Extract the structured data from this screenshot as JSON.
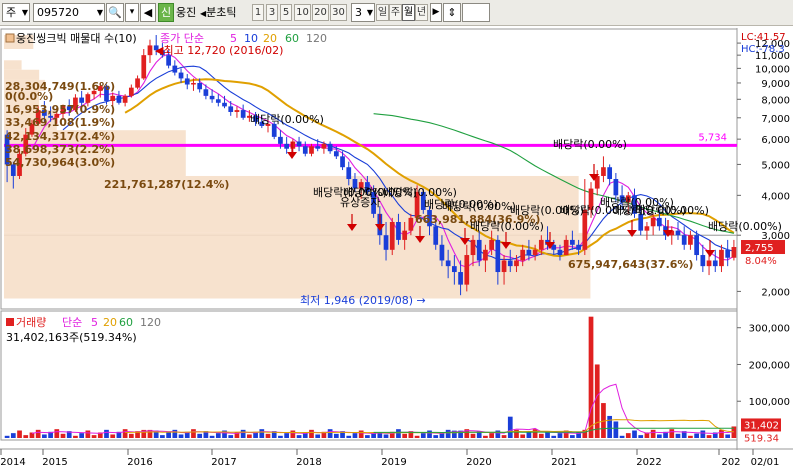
{
  "toolbar": {
    "market_select": "주",
    "stock_code": "095720",
    "credit_badge": "신",
    "stock_name_short": "웅진",
    "split_tick_label": "분초틱",
    "periods": [
      "1",
      "3",
      "5",
      "10",
      "20",
      "30"
    ],
    "period_count": "3",
    "period_units": [
      "일",
      "주",
      "월",
      "년"
    ],
    "selected_unit": "월"
  },
  "price_panel": {
    "legend_name": "웅진씽크빅 매물대 수(10)",
    "legend_ma": [
      "종가 단순",
      "5",
      "10",
      "20",
      "60",
      "120"
    ],
    "lc_label": "LC:41.57",
    "hc_label": "HC:-78.3",
    "high_label": "최고 12,720 (2016/02)",
    "low_label": "최저 1,946 (2019/08)",
    "ref_line_label": "5,734",
    "current_price": "2,755",
    "current_pct": "8.04%",
    "y_ticks": [
      "12,000",
      "11,000",
      "10,000",
      "9,000",
      "8,000",
      "7,000",
      "6,000",
      "5,000",
      "4,000",
      "3,000",
      "2,000"
    ],
    "volume_profile_labels": [
      "28,304,749(1.6%)",
      "0(0.0%)",
      "16,953,957(0.9%)",
      "33,469,108(1.9%)",
      "42,134,317(2.4%)",
      "38,698,373(2.2%)",
      "54,730,964(3.0%)",
      "221,761,287(12.4%)",
      "663,981,884(36.9%)",
      "675,947,643(37.6%)"
    ],
    "dividend_labels": [
      "배당락(0.00%)",
      "배당락(0.00%)",
      "배당락(0.00%)",
      "배당락(0.00%)",
      "배당락(0.00%)",
      "배당락(0.00%)",
      "배당락(0.00%)",
      "배당락(0.00%)",
      "배당락(0.00%)",
      "배당락(0.00%)",
      "배당락(0.00%)",
      "배당락(0.00%)",
      "배당락(0.00%)",
      "배당락(0.00%)"
    ],
    "rights_label": "유상증자"
  },
  "volume_panel": {
    "legend": [
      "거래량",
      "단순",
      "5",
      "20",
      "60",
      "120"
    ],
    "value_label": "31,402,163주(519.34%)",
    "y_ticks": [
      "300,000",
      "200,000",
      "100,000"
    ],
    "current_volume": "31,402",
    "current_pct": "519.34"
  },
  "x_axis": [
    "2014",
    "2015",
    "2016",
    "2017",
    "2018",
    "2019",
    "2020",
    "2021",
    "2022",
    "202",
    "02/01"
  ],
  "colors": {
    "up": "#e02020",
    "down": "#1a3ed8",
    "ma5": "#e020e0",
    "ma10": "#1a3ed8",
    "ma20": "#e0a000",
    "ma60": "#20a040",
    "ref_line": "#ff00ff",
    "profile": "#f6dfc9"
  },
  "chart_data": {
    "type": "candlestick",
    "start": "2014-02",
    "interval": "month",
    "ohlc": [
      [
        6200,
        6400,
        4400,
        5000
      ],
      [
        5000,
        5100,
        4200,
        4600
      ],
      [
        4600,
        5600,
        4500,
        5400
      ],
      [
        5400,
        6500,
        5300,
        6200
      ],
      [
        6200,
        6900,
        6100,
        6700
      ],
      [
        6700,
        7600,
        6600,
        7400
      ],
      [
        7400,
        7900,
        6800,
        7100
      ],
      [
        7100,
        7600,
        6800,
        7000
      ],
      [
        7000,
        7500,
        6700,
        7200
      ],
      [
        7200,
        7700,
        6900,
        7600
      ],
      [
        7600,
        8000,
        7100,
        7400
      ],
      [
        7400,
        8300,
        7300,
        8100
      ],
      [
        8100,
        8500,
        7600,
        7800
      ],
      [
        7800,
        8400,
        7600,
        8300
      ],
      [
        8300,
        8800,
        8000,
        8500
      ],
      [
        8500,
        9000,
        8100,
        8800
      ],
      [
        8800,
        8900,
        7700,
        7900
      ],
      [
        7900,
        8400,
        7500,
        8200
      ],
      [
        8200,
        8500,
        7700,
        7800
      ],
      [
        7800,
        8300,
        7600,
        8200
      ],
      [
        8200,
        8900,
        8100,
        8700
      ],
      [
        8700,
        9500,
        8600,
        9300
      ],
      [
        9300,
        11500,
        9200,
        11000
      ],
      [
        11000,
        12300,
        10400,
        11800
      ],
      [
        11800,
        12720,
        11000,
        11400
      ],
      [
        11400,
        12000,
        10800,
        11000
      ],
      [
        11000,
        11400,
        10000,
        10200
      ],
      [
        10200,
        10600,
        9500,
        9700
      ],
      [
        9700,
        10000,
        9000,
        9300
      ],
      [
        9300,
        9600,
        8600,
        8900
      ],
      [
        8900,
        9300,
        8500,
        9000
      ],
      [
        9000,
        9300,
        8400,
        8600
      ],
      [
        8600,
        8900,
        8000,
        8200
      ],
      [
        8200,
        8600,
        7800,
        8000
      ],
      [
        8000,
        8300,
        7600,
        7800
      ],
      [
        7800,
        8200,
        7500,
        7600
      ],
      [
        7600,
        7900,
        7100,
        7300
      ],
      [
        7300,
        7600,
        7000,
        7400
      ],
      [
        7400,
        7700,
        6900,
        7000
      ],
      [
        7000,
        7400,
        6800,
        7100
      ],
      [
        7100,
        7300,
        6600,
        6800
      ],
      [
        6800,
        7100,
        6500,
        6600
      ],
      [
        6600,
        6900,
        6300,
        6700
      ],
      [
        6700,
        6800,
        6000,
        6100
      ],
      [
        6100,
        6400,
        5600,
        5800
      ],
      [
        5800,
        6100,
        5400,
        5600
      ],
      [
        5600,
        6000,
        5400,
        5900
      ],
      [
        5900,
        6100,
        5500,
        5700
      ],
      [
        5700,
        5900,
        5300,
        5400
      ],
      [
        5400,
        5800,
        5300,
        5700
      ],
      [
        5700,
        6000,
        5500,
        5600
      ],
      [
        5600,
        5900,
        5400,
        5800
      ],
      [
        5800,
        5900,
        5400,
        5500
      ],
      [
        5500,
        5700,
        5200,
        5300
      ],
      [
        5300,
        5500,
        4800,
        4900
      ],
      [
        4900,
        5100,
        4300,
        4500
      ],
      [
        4500,
        4700,
        4100,
        4200
      ],
      [
        4200,
        4500,
        3900,
        4400
      ],
      [
        4400,
        4600,
        4000,
        4100
      ],
      [
        4100,
        4300,
        3400,
        3500
      ],
      [
        3500,
        3700,
        2800,
        3000
      ],
      [
        3000,
        3300,
        2500,
        2700
      ],
      [
        2700,
        3400,
        2600,
        3300
      ],
      [
        3300,
        3500,
        2800,
        2900
      ],
      [
        2900,
        3300,
        2700,
        3100
      ],
      [
        3100,
        3500,
        3000,
        3400
      ],
      [
        3400,
        4300,
        3300,
        4100
      ],
      [
        4100,
        4200,
        3500,
        3600
      ],
      [
        3600,
        3700,
        3000,
        3200
      ],
      [
        3200,
        3300,
        2700,
        2800
      ],
      [
        2800,
        3000,
        2400,
        2500
      ],
      [
        2500,
        2700,
        2200,
        2400
      ],
      [
        2400,
        2600,
        2100,
        2300
      ],
      [
        2300,
        2500,
        1946,
        2100
      ],
      [
        2100,
        2800,
        2000,
        2600
      ],
      [
        2600,
        3000,
        2400,
        2900
      ],
      [
        2900,
        3100,
        2400,
        2500
      ],
      [
        2500,
        2800,
        2300,
        2700
      ],
      [
        2700,
        3100,
        2600,
        2900
      ],
      [
        2900,
        3000,
        2100,
        2300
      ],
      [
        2300,
        2600,
        2100,
        2500
      ],
      [
        2500,
        2700,
        2300,
        2400
      ],
      [
        2400,
        2600,
        2300,
        2500
      ],
      [
        2500,
        2800,
        2400,
        2700
      ],
      [
        2700,
        2900,
        2500,
        2600
      ],
      [
        2600,
        2800,
        2500,
        2700
      ],
      [
        2700,
        3000,
        2600,
        2900
      ],
      [
        2900,
        3200,
        2700,
        2800
      ],
      [
        2800,
        2900,
        2600,
        2700
      ],
      [
        2700,
        2800,
        2500,
        2600
      ],
      [
        2600,
        3000,
        2600,
        2900
      ],
      [
        2900,
        3100,
        2700,
        2800
      ],
      [
        2800,
        2900,
        2600,
        2700
      ],
      [
        2700,
        4500,
        2600,
        3600
      ],
      [
        3600,
        4400,
        3400,
        4200
      ],
      [
        4200,
        4800,
        4000,
        4600
      ],
      [
        4600,
        5300,
        4400,
        4900
      ],
      [
        4900,
        5000,
        4300,
        4500
      ],
      [
        4500,
        4700,
        3800,
        4000
      ],
      [
        4000,
        4300,
        3600,
        3800
      ],
      [
        3800,
        4100,
        3500,
        4000
      ],
      [
        4000,
        4200,
        3400,
        3500
      ],
      [
        3500,
        3700,
        3000,
        3100
      ],
      [
        3100,
        3300,
        2900,
        3200
      ],
      [
        3200,
        3500,
        3000,
        3400
      ],
      [
        3400,
        3600,
        3100,
        3200
      ],
      [
        3200,
        3400,
        2900,
        3000
      ],
      [
        3000,
        3200,
        2800,
        3100
      ],
      [
        3100,
        3300,
        2900,
        3000
      ],
      [
        3000,
        3200,
        2700,
        2800
      ],
      [
        2800,
        3100,
        2700,
        3000
      ],
      [
        3000,
        3100,
        2500,
        2600
      ],
      [
        2600,
        2800,
        2300,
        2400
      ],
      [
        2400,
        2600,
        2250,
        2500
      ],
      [
        2500,
        2700,
        2300,
        2400
      ],
      [
        2400,
        2800,
        2300,
        2700
      ],
      [
        2700,
        2900,
        2400,
        2550
      ],
      [
        2550,
        2900,
        2500,
        2755
      ]
    ],
    "ref_price": 5734,
    "ylim": [
      1800,
      13000
    ],
    "volume_ylim": [
      0,
      340000
    ]
  }
}
